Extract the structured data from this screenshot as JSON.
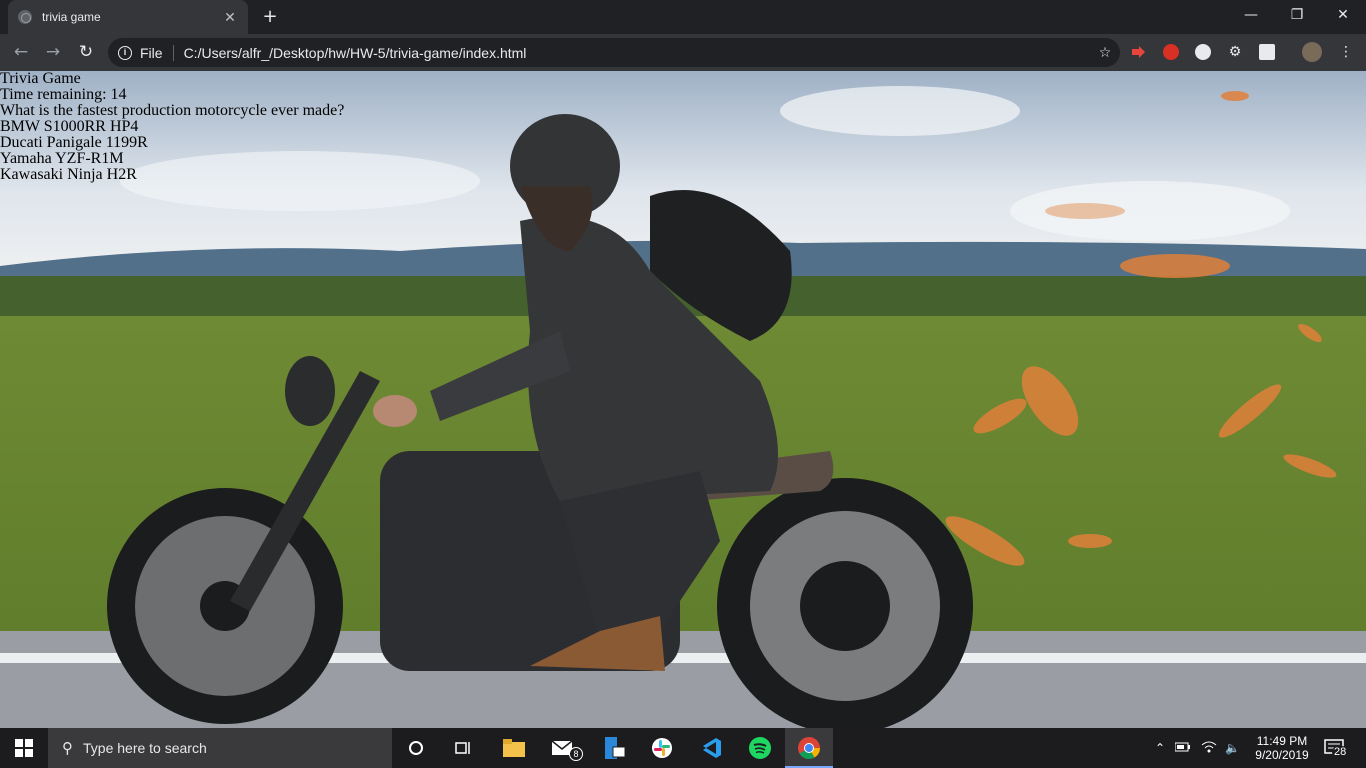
{
  "browser": {
    "tab_title": "trivia game",
    "tab_close": "✕",
    "new_tab": "+",
    "address_scheme": "File",
    "address_url": "C:/Users/alfr_/Desktop/hw/HW-5/trivia-game/index.html",
    "window_controls": {
      "minimize": "—",
      "restore": "❐",
      "close": "✕"
    }
  },
  "trivia": {
    "title": "Trivia Game",
    "timer": "Time remaining: 14",
    "question": "What is the fastest production motorcycle ever made?",
    "answers": [
      "BMW S1000RR HP4",
      "Ducati Panigale 1199R",
      "Yamaha YZF-R1M",
      "Kawasaki Ninja H2R"
    ]
  },
  "taskbar": {
    "search_placeholder": "Type here to search",
    "mail_badge": "8",
    "time": "11:49 PM",
    "date": "9/20/2019",
    "notification_count": "28"
  },
  "colors": {
    "chrome_bg": "#202124",
    "toolbar_bg": "#35363a",
    "taskbar_bg": "#1c1c1f"
  }
}
